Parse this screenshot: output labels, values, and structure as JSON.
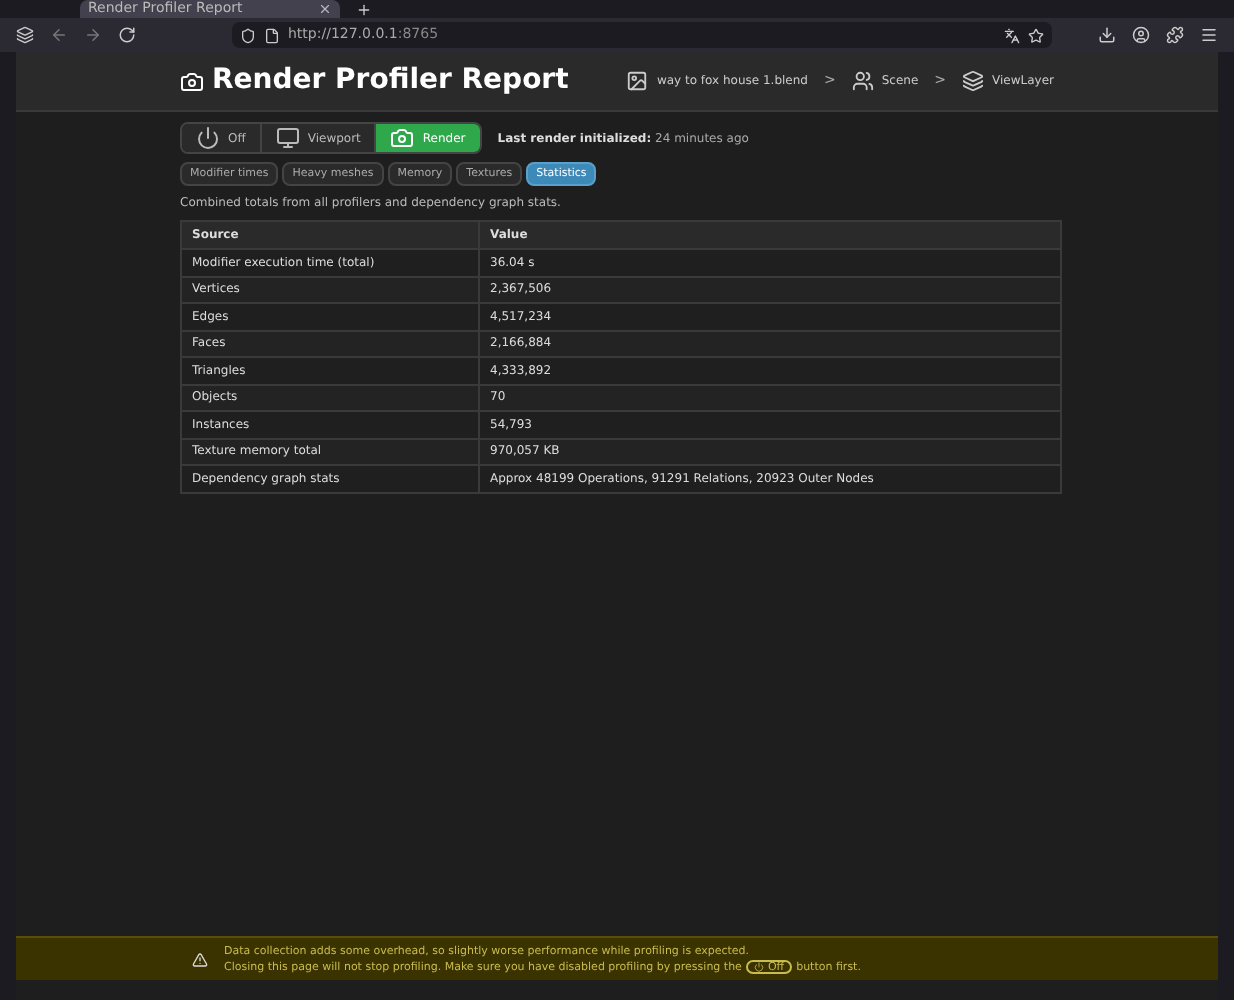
{
  "browser": {
    "tab_title": "Render Profiler Report",
    "url_host": "http://127.0.0.1",
    "url_port": ":8765"
  },
  "header": {
    "title": "Render Profiler Report",
    "breadcrumbs": [
      {
        "label": "way to fox house 1.blend",
        "kind": "file"
      },
      {
        "label": "Scene",
        "kind": "scene"
      },
      {
        "label": "ViewLayer",
        "kind": "layer"
      }
    ],
    "separator": ">"
  },
  "modes": [
    {
      "label": "Off",
      "kind": "power",
      "selected": false
    },
    {
      "label": "Viewport",
      "kind": "monitor",
      "selected": false
    },
    {
      "label": "Render",
      "kind": "camera",
      "selected": true
    }
  ],
  "status": {
    "label": "Last render initialized:",
    "value": "24 minutes ago"
  },
  "tabs": [
    {
      "label": "Modifier times",
      "selected": false
    },
    {
      "label": "Heavy meshes",
      "selected": false
    },
    {
      "label": "Memory",
      "selected": false
    },
    {
      "label": "Textures",
      "selected": false
    },
    {
      "label": "Statistics",
      "selected": true
    }
  ],
  "description": "Combined totals from all profilers and dependency graph stats.",
  "table": {
    "columns": [
      "Source",
      "Value"
    ],
    "rows": [
      [
        "Modifier execution time (total)",
        "36.04 s"
      ],
      [
        "Vertices",
        "2,367,506"
      ],
      [
        "Edges",
        "4,517,234"
      ],
      [
        "Faces",
        "2,166,884"
      ],
      [
        "Triangles",
        "4,333,892"
      ],
      [
        "Objects",
        "70"
      ],
      [
        "Instances",
        "54,793"
      ],
      [
        "Texture memory total",
        "970,057 KB"
      ],
      [
        "Dependency graph stats",
        "Approx 48199 Operations, 91291 Relations, 20923 Outer Nodes"
      ]
    ]
  },
  "warning": {
    "line1": "Data collection adds some overhead, so slightly worse performance while profiling is expected.",
    "line2_before": "Closing this page will not stop profiling. Make sure you have disabled profiling by pressing the",
    "button": "Off",
    "line2_after": "button first."
  }
}
